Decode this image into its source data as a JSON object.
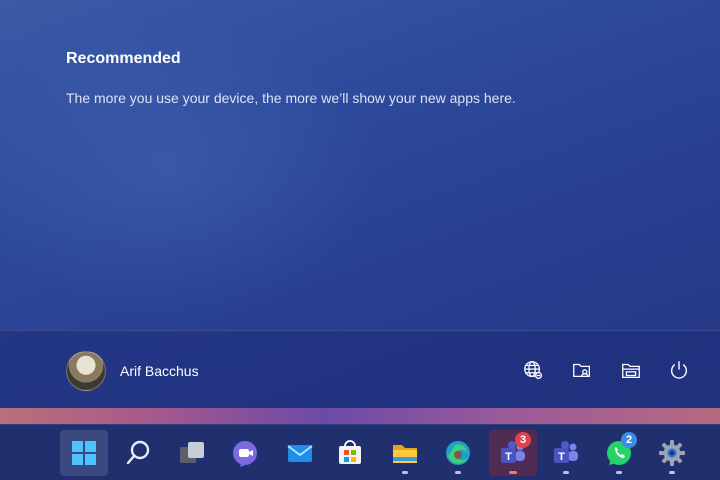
{
  "start_menu": {
    "recommended": {
      "title": "Recommended",
      "empty_message": "The more you use your device, the more we’ll show your new apps here."
    },
    "footer": {
      "user_name": "Arif Bacchus",
      "buttons": [
        {
          "name": "network",
          "icon": "globe-icon"
        },
        {
          "name": "file-explorer-settings",
          "icon": "folder-settings-icon"
        },
        {
          "name": "documents",
          "icon": "folder-icon"
        },
        {
          "name": "power",
          "icon": "power-icon"
        }
      ]
    }
  },
  "taskbar": {
    "apps": [
      {
        "name": "start",
        "icon": "windows-logo-icon",
        "active": true
      },
      {
        "name": "search",
        "icon": "search-icon"
      },
      {
        "name": "task-view",
        "icon": "task-view-icon"
      },
      {
        "name": "chat",
        "icon": "video-chat-icon"
      },
      {
        "name": "mail",
        "icon": "mail-icon"
      },
      {
        "name": "microsoft-store",
        "icon": "store-icon"
      },
      {
        "name": "file-explorer",
        "icon": "folder-icon",
        "running": true
      },
      {
        "name": "edge",
        "icon": "edge-icon",
        "running": true
      },
      {
        "name": "teams-work",
        "icon": "teams-icon",
        "running": true,
        "focused": true,
        "badge": "3",
        "badge_color": "#e0434a"
      },
      {
        "name": "teams",
        "icon": "teams-icon",
        "running": true
      },
      {
        "name": "whatsapp",
        "icon": "whatsapp-icon",
        "running": true,
        "badge": "2",
        "badge_color": "#3b8ee8"
      },
      {
        "name": "settings",
        "icon": "gear-icon",
        "running": true
      }
    ]
  },
  "colors": {
    "panel_bg": "#2e4b9d",
    "taskbar_bg": "#20306f",
    "text_primary": "#ffffff",
    "badge_red": "#e0434a",
    "badge_blue": "#3b8ee8"
  }
}
